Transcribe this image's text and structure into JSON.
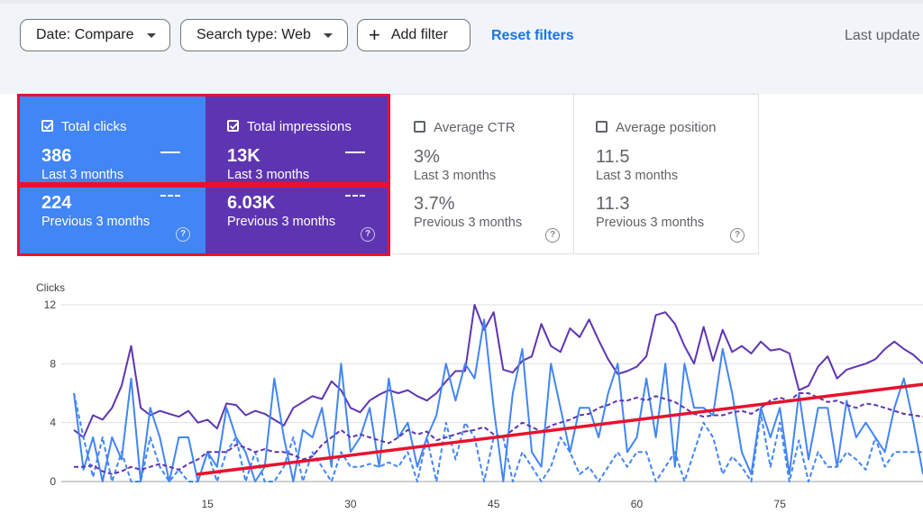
{
  "filters": {
    "date_label": "Date: Compare",
    "search_type_label": "Search type: Web",
    "add_filter_label": "Add filter",
    "reset_label": "Reset filters",
    "last_updated": "Last update"
  },
  "metrics": [
    {
      "label": "Total clicks",
      "checked": true,
      "current": "386",
      "current_label": "Last 3 months",
      "previous": "224",
      "previous_label": "Previous 3 months"
    },
    {
      "label": "Total impressions",
      "checked": true,
      "current": "13K",
      "current_label": "Last 3 months",
      "previous": "6.03K",
      "previous_label": "Previous 3 months"
    },
    {
      "label": "Average CTR",
      "checked": false,
      "current": "3%",
      "current_label": "Last 3 months",
      "previous": "3.7%",
      "previous_label": "Previous 3 months"
    },
    {
      "label": "Average position",
      "checked": false,
      "current": "11.5",
      "current_label": "Last 3 months",
      "previous": "11.3",
      "previous_label": "Previous 3 months"
    }
  ],
  "colors": {
    "clicks": "#4285f4",
    "impressions": "#5e35b1",
    "annotation": "#e8122e",
    "link": "#1a73e8"
  },
  "icons": {
    "checkbox": "check-icon",
    "help": "help-icon",
    "add": "plus-icon",
    "dropdown": "caret-down-icon"
  },
  "chart_data": {
    "type": "line",
    "ylabel": "Clicks",
    "y_ticks": [
      0,
      4,
      8,
      12
    ],
    "x_ticks": [
      15,
      30,
      45,
      60,
      75
    ],
    "ylim": [
      0,
      12
    ],
    "xlim": [
      1,
      90
    ],
    "series": [
      {
        "style": "solid",
        "color": "#5e35b1",
        "values": [
          3.5,
          3,
          4.5,
          4.2,
          5,
          6.5,
          9.2,
          5,
          4.5,
          4.8,
          4.6,
          4.4,
          4.8,
          4,
          4.2,
          3.6,
          5.3,
          5.2,
          4.5,
          4.8,
          4.6,
          4.2,
          3.8,
          5,
          5.4,
          5.8,
          5.6,
          6.8,
          6.2,
          5,
          4.7,
          5.5,
          5.9,
          6.2,
          6,
          6.2,
          5.8,
          5.5,
          6,
          6.8,
          7.5,
          7.5,
          12,
          10.3,
          11.5,
          7.6,
          7.4,
          8.2,
          8.5,
          10.7,
          9.2,
          8.8,
          10.4,
          9.8,
          11,
          9.6,
          8.3,
          7.3,
          7.5,
          7.8,
          8.5,
          11.3,
          11.5,
          10.7,
          9.2,
          8,
          10.5,
          8.2,
          10.3,
          8.8,
          9.2,
          8.7,
          9.5,
          8.9,
          9,
          8.7,
          6.2,
          6.5,
          7.8,
          8.5,
          7,
          7.6,
          7.8,
          8,
          8.3,
          9,
          9.5,
          9,
          8.6,
          8
        ]
      },
      {
        "style": "solid",
        "color": "#4285f4",
        "values": [
          6,
          0.8,
          3,
          0,
          3,
          1.5,
          7,
          0,
          5,
          3,
          0,
          3,
          3,
          0,
          2,
          1,
          5,
          3,
          2,
          0,
          1,
          7,
          3,
          0,
          3.5,
          3,
          5,
          1,
          8,
          2,
          3,
          5,
          1,
          7,
          3,
          4,
          1,
          3,
          4.5,
          8,
          5.5,
          8,
          7,
          11,
          5,
          0,
          6,
          9,
          2,
          1,
          8,
          5,
          2,
          5,
          5,
          3,
          6,
          8,
          2,
          3,
          7,
          3,
          8,
          1,
          8,
          5,
          5,
          4.5,
          9,
          6,
          2,
          0.5,
          5,
          3,
          5,
          0.5,
          6,
          1.5,
          5,
          5,
          1,
          5.5,
          3,
          4,
          3,
          2,
          5,
          7,
          4,
          0.5
        ]
      },
      {
        "style": "dashed",
        "color": "#4285f4",
        "values": [
          6,
          3,
          0.3,
          3,
          0,
          2,
          0,
          0,
          3,
          1,
          0,
          0.8,
          0,
          0,
          2,
          0,
          2,
          3,
          0,
          2,
          0,
          0,
          1,
          3,
          0,
          2,
          1,
          0,
          2,
          1,
          1,
          1.2,
          1,
          1.3,
          1,
          2,
          0,
          3,
          0,
          4,
          1.5,
          4,
          3,
          0,
          3,
          3,
          0,
          2,
          1,
          0,
          1,
          3,
          2,
          0.5,
          1,
          0,
          1,
          2,
          1,
          2,
          2,
          0,
          1,
          2,
          0,
          2,
          4,
          3,
          0.5,
          1.7,
          1,
          0,
          4.6,
          1,
          4,
          0,
          2.8,
          0,
          2,
          1,
          1,
          2,
          1.5,
          0.8,
          3,
          1,
          2,
          2,
          2,
          2
        ]
      },
      {
        "style": "dashed",
        "color": "#5e35b1",
        "values": [
          1,
          1,
          1.1,
          0.7,
          0.5,
          0.7,
          1,
          0.8,
          1,
          1.2,
          1,
          0.8,
          1.2,
          1.5,
          2,
          2,
          2,
          2.5,
          2.3,
          2,
          2.2,
          2,
          2,
          1.8,
          1.5,
          1.7,
          2.5,
          3,
          3.5,
          3,
          3.2,
          3,
          2.8,
          2.6,
          3,
          3.5,
          3.2,
          3.4,
          2.8,
          3,
          3.2,
          3.4,
          3.5,
          3.7,
          3.2,
          3,
          3.5,
          4,
          3.7,
          3.4,
          3.8,
          4,
          4.2,
          4.5,
          4.6,
          5,
          5.2,
          5.5,
          5.5,
          5.7,
          5.5,
          5.8,
          5.6,
          5.4,
          5,
          4.6,
          4.4,
          4.5,
          4.5,
          4.7,
          4.8,
          4.6,
          5,
          5.5,
          5.7,
          5.5,
          6,
          6,
          5.7,
          5.4,
          5.5,
          5.2,
          5,
          5.3,
          5.2,
          5,
          4.8,
          4.6,
          4.5,
          4.4
        ]
      }
    ],
    "annotation": {
      "type": "trend-line",
      "color": "#e8122e",
      "from": [
        14,
        0.5
      ],
      "to": [
        90,
        6.6
      ]
    }
  }
}
